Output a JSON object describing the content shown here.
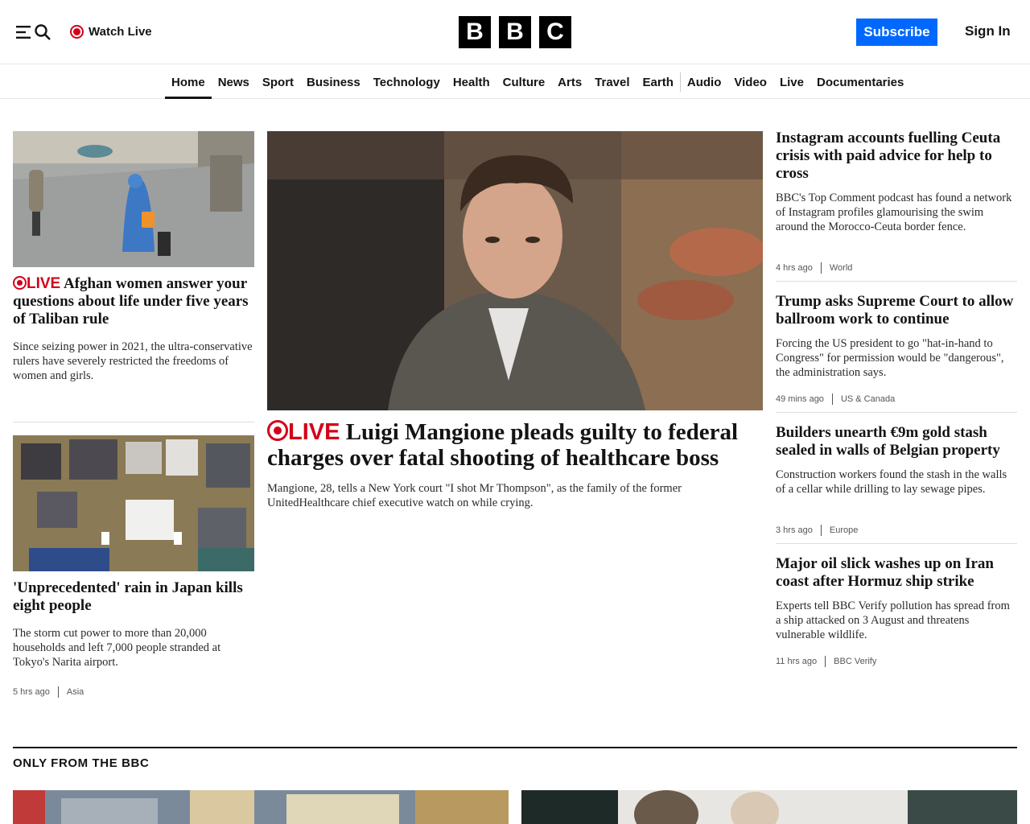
{
  "header": {
    "watch_live": "Watch Live",
    "logo_letters": [
      "B",
      "B",
      "C"
    ],
    "subscribe": "Subscribe",
    "sign_in": "Sign In"
  },
  "nav": {
    "items": [
      "Home",
      "News",
      "Sport",
      "Business",
      "Technology",
      "Health",
      "Culture",
      "Arts",
      "Travel",
      "Earth",
      "Audio",
      "Video",
      "Live",
      "Documentaries"
    ],
    "active": "Home"
  },
  "stories": {
    "left1": {
      "live_label": "LIVE",
      "headline": "Afghan women answer your questions about life under five years of Taliban rule",
      "summary": "Since seizing power in 2021, the ultra-conservative rulers have severely restricted the freedoms of women and girls."
    },
    "left2": {
      "headline": "'Unprecedented' rain in Japan kills eight people",
      "summary": "The storm cut power to more than 20,000 households and left 7,000 people stranded at Tokyo's Narita airport.",
      "time": "5 hrs ago",
      "tag": "Asia"
    },
    "main": {
      "live_label": "LIVE",
      "headline": "Luigi Mangione pleads guilty to federal charges over fatal shooting of healthcare boss",
      "summary": "Mangione, 28, tells a New York court \"I shot Mr Thompson\", as the family of the former UnitedHealthcare chief executive watch on while crying."
    },
    "right": [
      {
        "headline": "Instagram accounts fuelling Ceuta crisis with paid advice for help to cross",
        "summary": "BBC's Top Comment podcast has found a network of Instagram profiles glamourising the swim around the Morocco-Ceuta border fence.",
        "time": "4 hrs ago",
        "tag": "World"
      },
      {
        "headline": "Trump asks Supreme Court to allow ballroom work to continue",
        "summary": "Forcing the US president to go \"hat-in-hand to Congress\" for permission would be \"dangerous\", the administration says.",
        "time": "49 mins ago",
        "tag": "US & Canada"
      },
      {
        "headline": "Builders unearth €9m gold stash sealed in walls of Belgian property",
        "summary": "Construction workers found the stash in the walls of a cellar while drilling to lay sewage pipes.",
        "time": "3 hrs ago",
        "tag": "Europe"
      },
      {
        "headline": "Major oil slick washes up on Iran coast after Hormuz ship strike",
        "summary": "Experts tell BBC Verify pollution has spread from a ship attacked on 3 August and threatens vulnerable wildlife.",
        "time": "11 hrs ago",
        "tag": "BBC Verify"
      }
    ]
  },
  "section": {
    "title": "ONLY FROM THE BBC"
  },
  "colors": {
    "accent_blue": "#0068ff",
    "live_red": "#d4001a"
  }
}
